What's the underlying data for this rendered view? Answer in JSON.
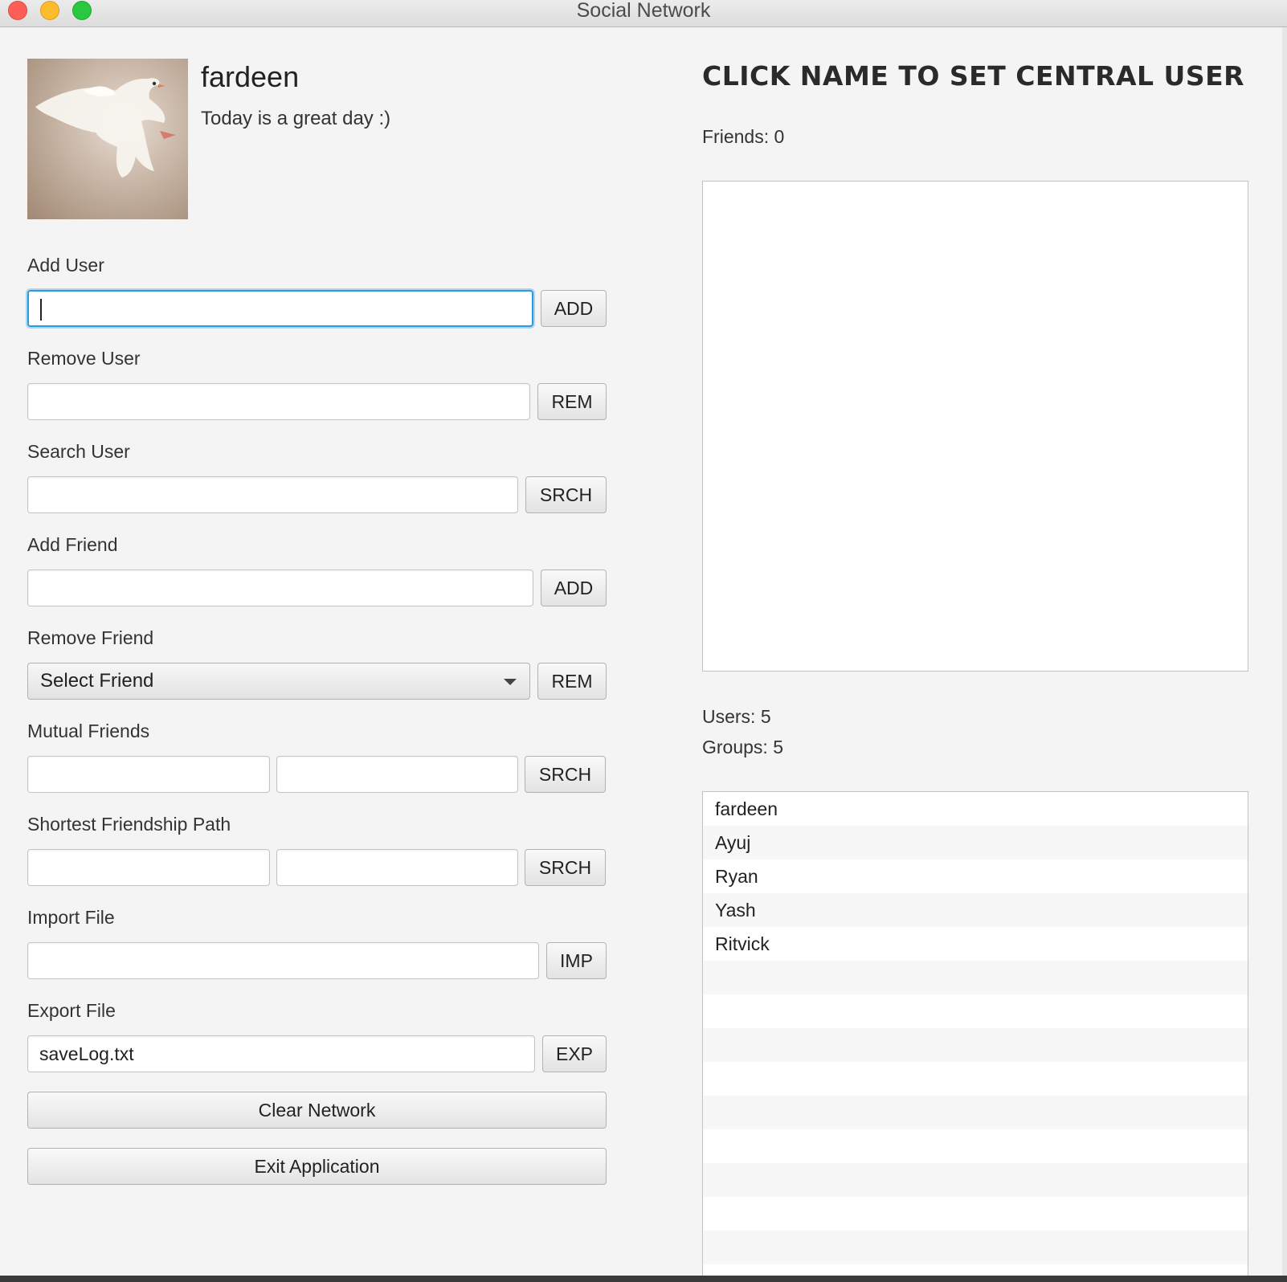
{
  "window": {
    "title": "Social Network"
  },
  "profile": {
    "name": "fardeen",
    "status": "Today is a great day :)",
    "avatar_icon": "dove-photo"
  },
  "add_user": {
    "label": "Add User",
    "value": "",
    "button": "ADD"
  },
  "remove_user": {
    "label": "Remove User",
    "value": "",
    "button": "REM"
  },
  "search_user": {
    "label": "Search User",
    "value": "",
    "button": "SRCH"
  },
  "add_friend": {
    "label": "Add Friend",
    "value": "",
    "button": "ADD"
  },
  "remove_friend": {
    "label": "Remove Friend",
    "select_value": "Select Friend",
    "button": "REM"
  },
  "mutual_friends": {
    "label": "Mutual Friends",
    "value1": "",
    "value2": "",
    "button": "SRCH"
  },
  "shortest_path": {
    "label": "Shortest Friendship Path",
    "value1": "",
    "value2": "",
    "button": "SRCH"
  },
  "import_file": {
    "label": "Import File",
    "value": "",
    "button": "IMP"
  },
  "export_file": {
    "label": "Export File",
    "value": "saveLog.txt",
    "button": "EXP"
  },
  "actions": {
    "clear": "Clear Network",
    "exit": "Exit Application"
  },
  "right": {
    "heading": "CLICK NAME TO SET CENTRAL USER",
    "friends_count": "Friends: 0",
    "users_count": "Users: 5",
    "groups_count": "Groups: 5"
  },
  "users": [
    "fardeen",
    "Ayuj",
    "Ryan",
    "Yash",
    "Ritvick"
  ],
  "colors": {
    "focus_ring": "#2a9cdc",
    "background": "#f4f4f4"
  }
}
